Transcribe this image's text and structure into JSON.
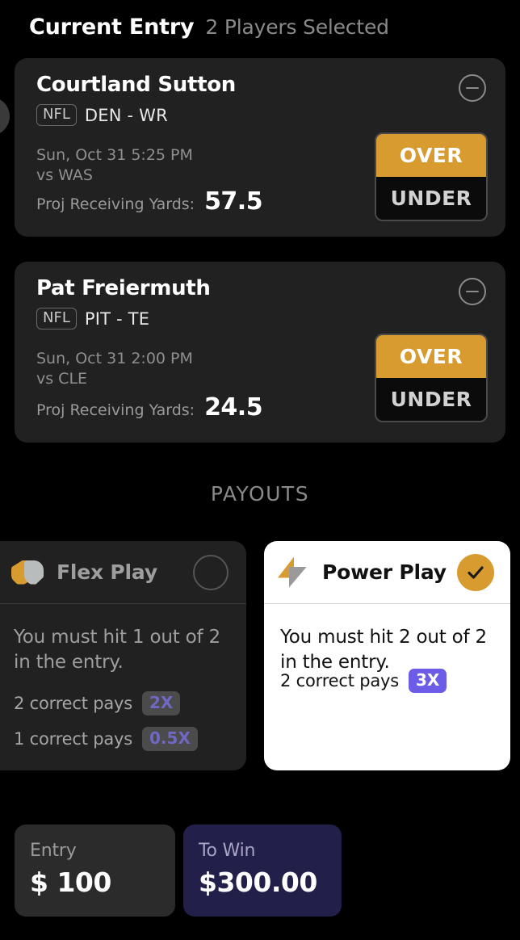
{
  "header": {
    "title": "Current Entry",
    "subtitle": "2 Players Selected"
  },
  "players": [
    {
      "name": "Courtland Sutton",
      "league": "NFL",
      "team_position": "DEN - WR",
      "game_time": "Sun, Oct 31 5:25 PM",
      "opponent": "vs WAS",
      "stat_label": "Proj Receiving Yards:",
      "stat_value": "57.5",
      "over_label": "OVER",
      "under_label": "UNDER",
      "selection": "OVER"
    },
    {
      "name": "Pat Freiermuth",
      "league": "NFL",
      "team_position": "PIT - TE",
      "game_time": "Sun, Oct 31 2:00 PM",
      "opponent": "vs CLE",
      "stat_label": "Proj Receiving Yards:",
      "stat_value": "24.5",
      "over_label": "OVER",
      "under_label": "UNDER",
      "selection": "OVER"
    }
  ],
  "payouts": {
    "heading": "PAYOUTS",
    "options": [
      {
        "title": "Flex Play",
        "selected": false,
        "description": "You must hit 1 out of 2 in the entry.",
        "rules": [
          {
            "text": "2 correct pays",
            "multiplier": "2X"
          },
          {
            "text": "1 correct pays",
            "multiplier": "0.5X"
          }
        ]
      },
      {
        "title": "Power Play",
        "selected": true,
        "description": "You must hit 2 out of 2 in the entry.",
        "rules": [
          {
            "text": "2 correct pays",
            "multiplier": "3X"
          }
        ]
      }
    ]
  },
  "entry_bar": {
    "stake_label": "Entry",
    "stake_value": "$ 100",
    "towin_label": "To Win",
    "towin_value": "$300.00"
  },
  "colors": {
    "accent_amber": "#d89b30",
    "accent_purple": "#6c5ce7",
    "towin_navy": "#221f4a",
    "card_dark": "#212121",
    "page_background": "#000000"
  }
}
